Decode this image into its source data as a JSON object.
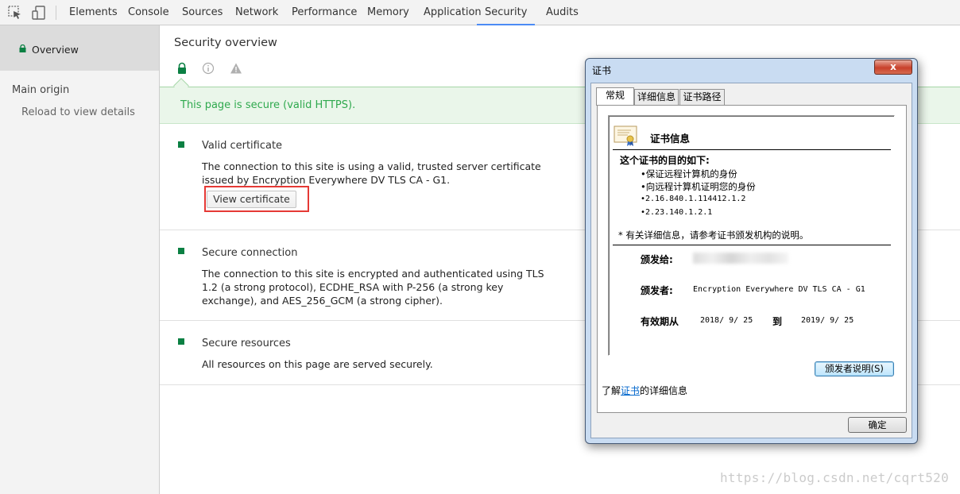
{
  "toolbar": {
    "inspect_icon": "inspect-cursor-icon",
    "device_icon": "device-toggle-icon",
    "tabs": [
      "Elements",
      "Console",
      "Sources",
      "Network",
      "Performance",
      "Memory",
      "Application",
      "Security",
      "Audits"
    ],
    "active_tab": "Security"
  },
  "sidebar": {
    "overview": "Overview",
    "main_origin": "Main origin",
    "reload": "Reload to view details"
  },
  "main": {
    "title": "Security overview",
    "banner": "This page is secure (valid HTTPS).",
    "sections": [
      {
        "title": "Valid certificate",
        "description": "The connection to this site is using a valid, trusted server certificate issued by Encryption Everywhere DV TLS CA - G1.",
        "button": "View certificate"
      },
      {
        "title": "Secure connection",
        "description": "The connection to this site is encrypted and authenticated using TLS 1.2 (a strong protocol), ECDHE_RSA with P-256 (a strong key exchange), and AES_256_GCM (a strong cipher)."
      },
      {
        "title": "Secure resources",
        "description": "All resources on this page are served securely."
      }
    ]
  },
  "dialog": {
    "title": "证书",
    "close": "x",
    "tabs": [
      "常规",
      "详细信息",
      "证书路径"
    ],
    "cert_heading": "证书信息",
    "purpose_title": "这个证书的目的如下:",
    "purposes": [
      "•保证远程计算机的身份",
      "•向远程计算机证明您的身份",
      "•2.16.840.1.114412.1.2",
      "•2.23.140.1.2.1"
    ],
    "note": "* 有关详细信息，请参考证书颁发机构的说明。",
    "issued_to_label": "颁发给:",
    "issued_by_label": "颁发者:",
    "issued_by_value": "Encryption Everywhere DV TLS CA - G1",
    "valid_label": "有效期从",
    "valid_from": "2018/ 9/ 25",
    "valid_to_label": "到",
    "valid_to": "2019/ 9/ 25",
    "issuer_statement_button": "颁发者说明(S)",
    "learn_prefix": "了解",
    "learn_link": "证书",
    "learn_suffix": "的详细信息",
    "ok_button": "确定"
  },
  "watermark": "https://blog.csdn.net/cqrt520",
  "colors": {
    "secure_green": "#0b8043",
    "banner_text": "#2fa94e",
    "active_tab_underline": "#4c8bf5",
    "highlight_box": "#e53935"
  }
}
